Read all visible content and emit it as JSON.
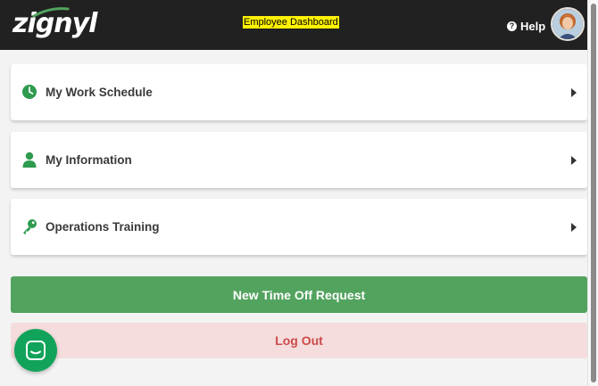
{
  "header": {
    "logo_text": "zignyl",
    "page_title": "Employee Dashboard",
    "help_label": "Help",
    "help_icon": "question-circle-icon",
    "avatar": "user-avatar"
  },
  "menu": {
    "items": [
      {
        "label": "My Work Schedule",
        "icon": "clock-icon"
      },
      {
        "label": "My Information",
        "icon": "user-icon"
      },
      {
        "label": "Operations Training",
        "icon": "key-icon"
      }
    ]
  },
  "actions": {
    "time_off_label": "New Time Off Request",
    "logout_label": "Log Out"
  },
  "colors": {
    "topbar": "#212121",
    "accent_green": "#52a35e",
    "icon_green": "#2e9b4e",
    "logout_bg": "#f5dddd",
    "logout_text": "#cc4a4a",
    "chat_fab": "#12a35a",
    "title_highlight": "#fff200"
  }
}
